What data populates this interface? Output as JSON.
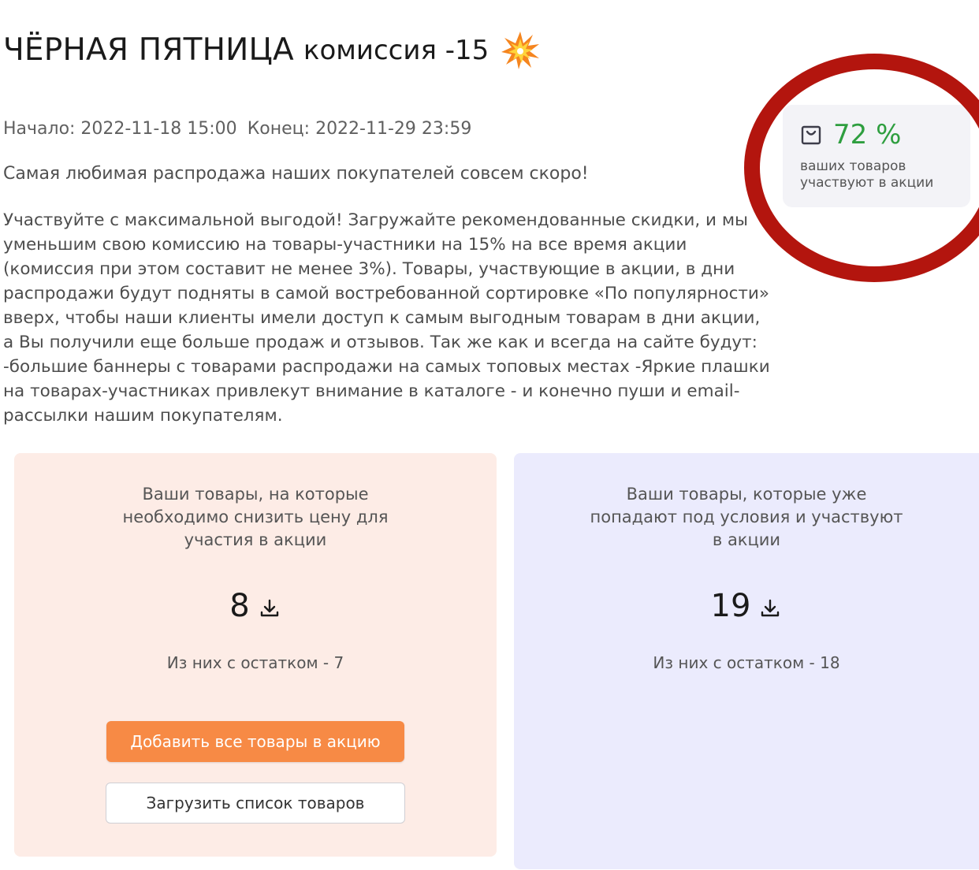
{
  "promo": {
    "title_main": "ЧЁРНАЯ ПЯТНИЦА",
    "title_rest": "комиссия -15",
    "start": "Начало: 2022-11-18 15:00",
    "end": "Конец: 2022-11-29 23:59",
    "lead": "Самая любимая распродажа наших покупателей совсем скоро!",
    "body_lines": [
      "Участвуйте с максимальной выгодой! Загружайте рекомендованные скидки, и мы",
      "уменьшим свою комиссию на товары-участники на 15% на все время акции",
      "(комиссия при этом составит не менее 3%). Товары, участвующие в акции, в дни",
      "распродажи будут подняты в самой востребованной сортировке «По популярности»",
      "вверх, чтобы наши клиенты имели доступ к самым выгодным товарам в дни акции,",
      "а Вы получили еще больше продаж и отзывов. Так же как и всегда на сайте будут:",
      "-большие баннеры с товарами распродажи на самых топовых местах -Яркие плашки",
      "на товарах-участниках привлекут внимание в каталоге - и конечно пуши и email-",
      "рассылки нашим покупателям."
    ]
  },
  "stats": {
    "percent": "72 %",
    "percent_value": 72,
    "label_lines": [
      "ваших товаров",
      "участвуют в акции"
    ],
    "percent_color": "#2e9e3f"
  },
  "panels": {
    "need_discount": {
      "desc_lines": [
        "Ваши товары, на которые",
        "необходимо снизить цену для",
        "участия в акции"
      ],
      "count": "8",
      "remain": "Из них с остатком - 7",
      "add_button": "Добавить все товары в акцию",
      "upload_button": "Загрузить список товаров",
      "bg_color": "#fdece6",
      "button_color": "#f78a45"
    },
    "participating": {
      "desc_lines": [
        "Ваши товары, которые уже",
        "попадают под условия и участвуют",
        "в акции"
      ],
      "count": "19",
      "remain": "Из них с остатком - 18",
      "bg_color": "#ebebfd"
    }
  },
  "icons": {
    "title_icon": "collision-icon",
    "stat_icon": "shopping-bag-icon",
    "count_icon": "download-icon"
  },
  "annotation": {
    "highlight_color": "#b3150e"
  }
}
